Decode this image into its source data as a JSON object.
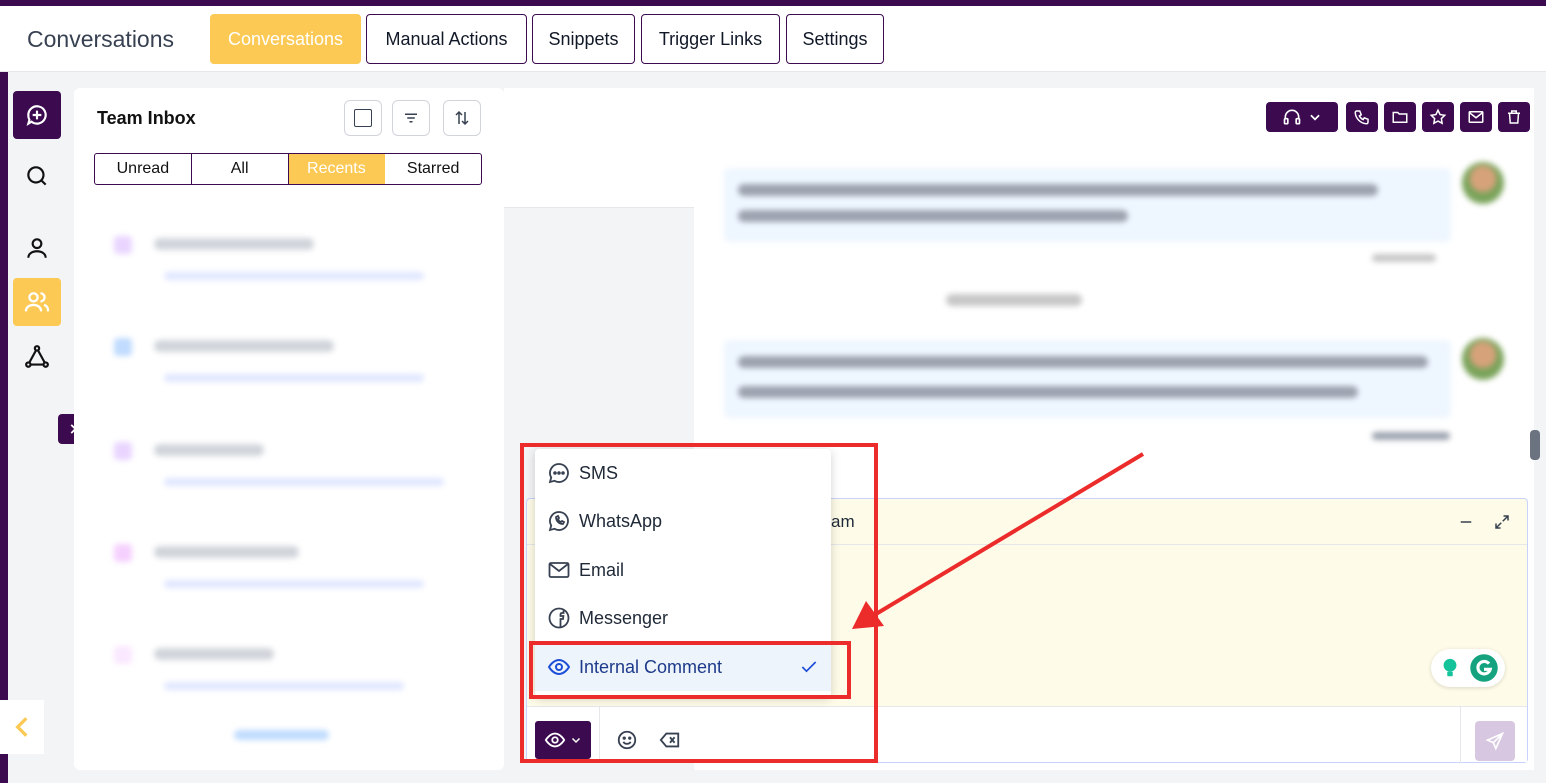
{
  "header": {
    "app_title": "Conversations",
    "tabs": [
      {
        "label": "Conversations",
        "active": true
      },
      {
        "label": "Manual Actions",
        "active": false
      },
      {
        "label": "Snippets",
        "active": false
      },
      {
        "label": "Trigger Links",
        "active": false
      },
      {
        "label": "Settings",
        "active": false
      }
    ]
  },
  "inbox": {
    "title": "Team Inbox",
    "filters": [
      {
        "label": "Unread",
        "active": false
      },
      {
        "label": "All",
        "active": false
      },
      {
        "label": "Recents",
        "active": true
      },
      {
        "label": "Starred",
        "active": false
      }
    ]
  },
  "composer": {
    "header_fragment": "am"
  },
  "channel_menu": {
    "items": [
      {
        "label": "SMS",
        "icon": "chat-bubble-icon",
        "selected": false
      },
      {
        "label": "WhatsApp",
        "icon": "whatsapp-icon",
        "selected": false
      },
      {
        "label": "Email",
        "icon": "email-icon",
        "selected": false
      },
      {
        "label": "Messenger",
        "icon": "facebook-icon",
        "selected": false
      },
      {
        "label": "Internal Comment",
        "icon": "eye-icon",
        "selected": true
      }
    ]
  },
  "colors": {
    "brand_purple": "#3b0a4f",
    "accent_yellow": "#fcc954",
    "highlight_red": "#ec2b2b"
  }
}
